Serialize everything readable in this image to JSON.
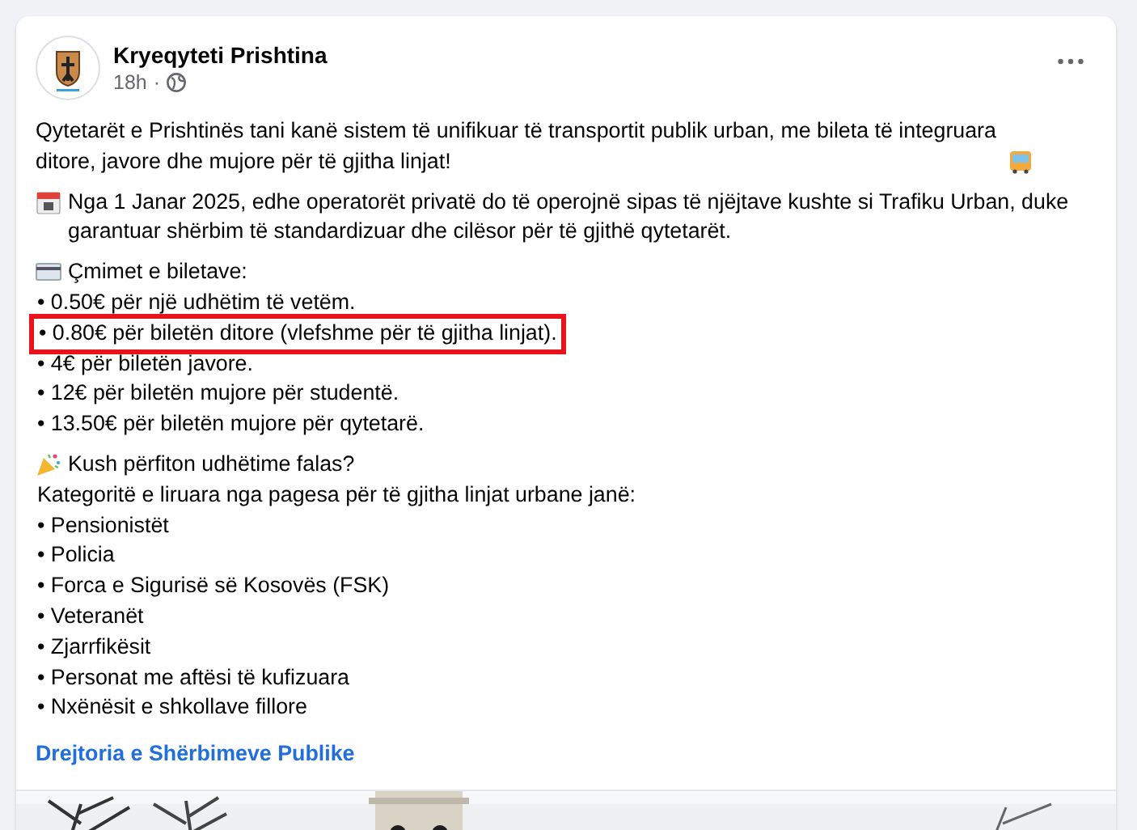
{
  "post": {
    "author": "Kryeqyteti Prishtina",
    "time": "18h",
    "separator": "·",
    "intro": "Qytetarët e Prishtinës tani kanë sistem të unifikuar të transportit publik urban, me bileta të integruara ditore, javore dhe mujore për të gjitha linjat!",
    "announcement": "Nga 1 Janar 2025, edhe operatorët privatë do të operojnë sipas të njëjtave kushte si Trafiku Urban, duke garantuar shërbim të standardizuar dhe cilësor për të gjithë qytetarët.",
    "prices_heading": "Çmimet e biletave:",
    "prices": [
      {
        "text": "• 0.50€ për një udhëtim të vetëm.",
        "highlighted": false
      },
      {
        "text": "• 0.80€ për biletën ditore (vlefshme për të gjitha linjat).",
        "highlighted": true
      },
      {
        "text": "• 4€ për biletën javore.",
        "highlighted": false
      },
      {
        "text": "• 12€ për biletën mujore për studentë.",
        "highlighted": false
      },
      {
        "text": "• 13.50€ për biletën mujore për qytetarë.",
        "highlighted": false
      }
    ],
    "free_heading": "Kush përfiton udhëtime falas?",
    "free_intro": "Kategoritë e liruara nga pagesa për të gjitha linjat urbane janë:",
    "free": [
      "• Pensionistët",
      "• Policia",
      "• Forca e Sigurisë së Kosovës (FSK)",
      "• Veteranët",
      "• Zjarrfikësit",
      "• Personat me aftësi të kufizuara",
      "• Nxënësit e shkollave fillore"
    ],
    "link": "Drejtoria e Shërbimeve Publike"
  }
}
